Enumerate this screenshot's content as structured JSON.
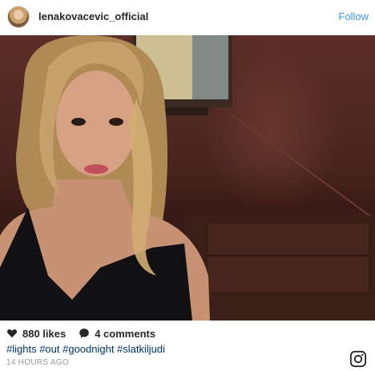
{
  "post": {
    "username": "lenakovacevic_official",
    "follow_label": "Follow",
    "likes": "880 likes",
    "comments": "4 comments",
    "hashtags": "#lights #out #goodnight #slatkiljudi",
    "timestamp": "14 HOURS AGO"
  },
  "icons": {
    "like": "heart-icon",
    "comment": "comment-bubble-icon",
    "brand": "instagram-logo-icon",
    "avatar": "profile-avatar"
  },
  "colors": {
    "follow": "#3897f0",
    "hashtag": "#003569",
    "timestamp": "#999999",
    "text": "#262626"
  }
}
